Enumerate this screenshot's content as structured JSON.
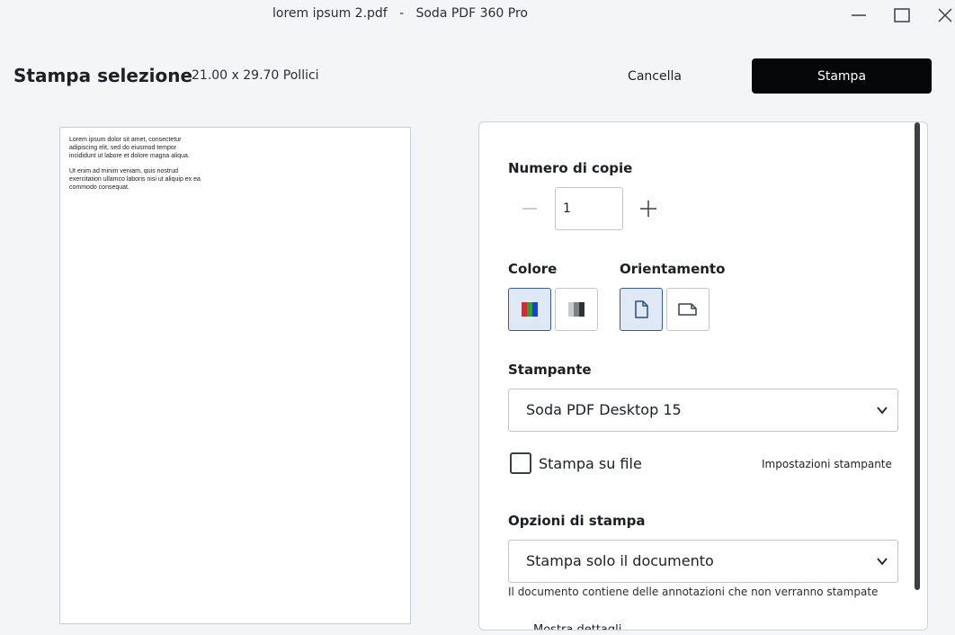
{
  "window": {
    "title": "lorem ipsum 2.pdf   -   Soda PDF 360 Pro"
  },
  "header": {
    "title": "Stampa selezione",
    "page_size": "21.00 x 29.70 Pollici",
    "cancel_label": "Cancella",
    "print_label": "Stampa"
  },
  "preview": {
    "paragraphs": [
      "Lorem ipsum dolor sit amet, consectetur adipiscing elit, sed do eiusmod tempor incididunt ut labore et dolore magna aliqua.",
      "Ut enim ad minim veniam, quis nostrud exercitation ullamco laboris nisi ut aliquip ex ea commodo consequat."
    ]
  },
  "settings": {
    "copies_label": "Numero di copie",
    "copies_value": "1",
    "color_label": "Colore",
    "color_selected": "color",
    "orientation_label": "Orientamento",
    "orientation_selected": "portrait",
    "printer_label": "Stampante",
    "printer_value": "Soda PDF Desktop 15",
    "print_to_file_label": "Stampa su file",
    "print_to_file_checked": false,
    "printer_settings_link": "Impostazioni stampante",
    "options_label": "Opzioni di stampa",
    "options_value": "Stampa solo il documento",
    "options_note": "Il documento contiene delle annotazioni che non verranno stampate",
    "cut_off_text": "Mostra dettagli"
  },
  "colors": {
    "primary_button": "#050607",
    "selected_bg": "#dfe8f5",
    "selected_border": "#3a5a8c"
  }
}
